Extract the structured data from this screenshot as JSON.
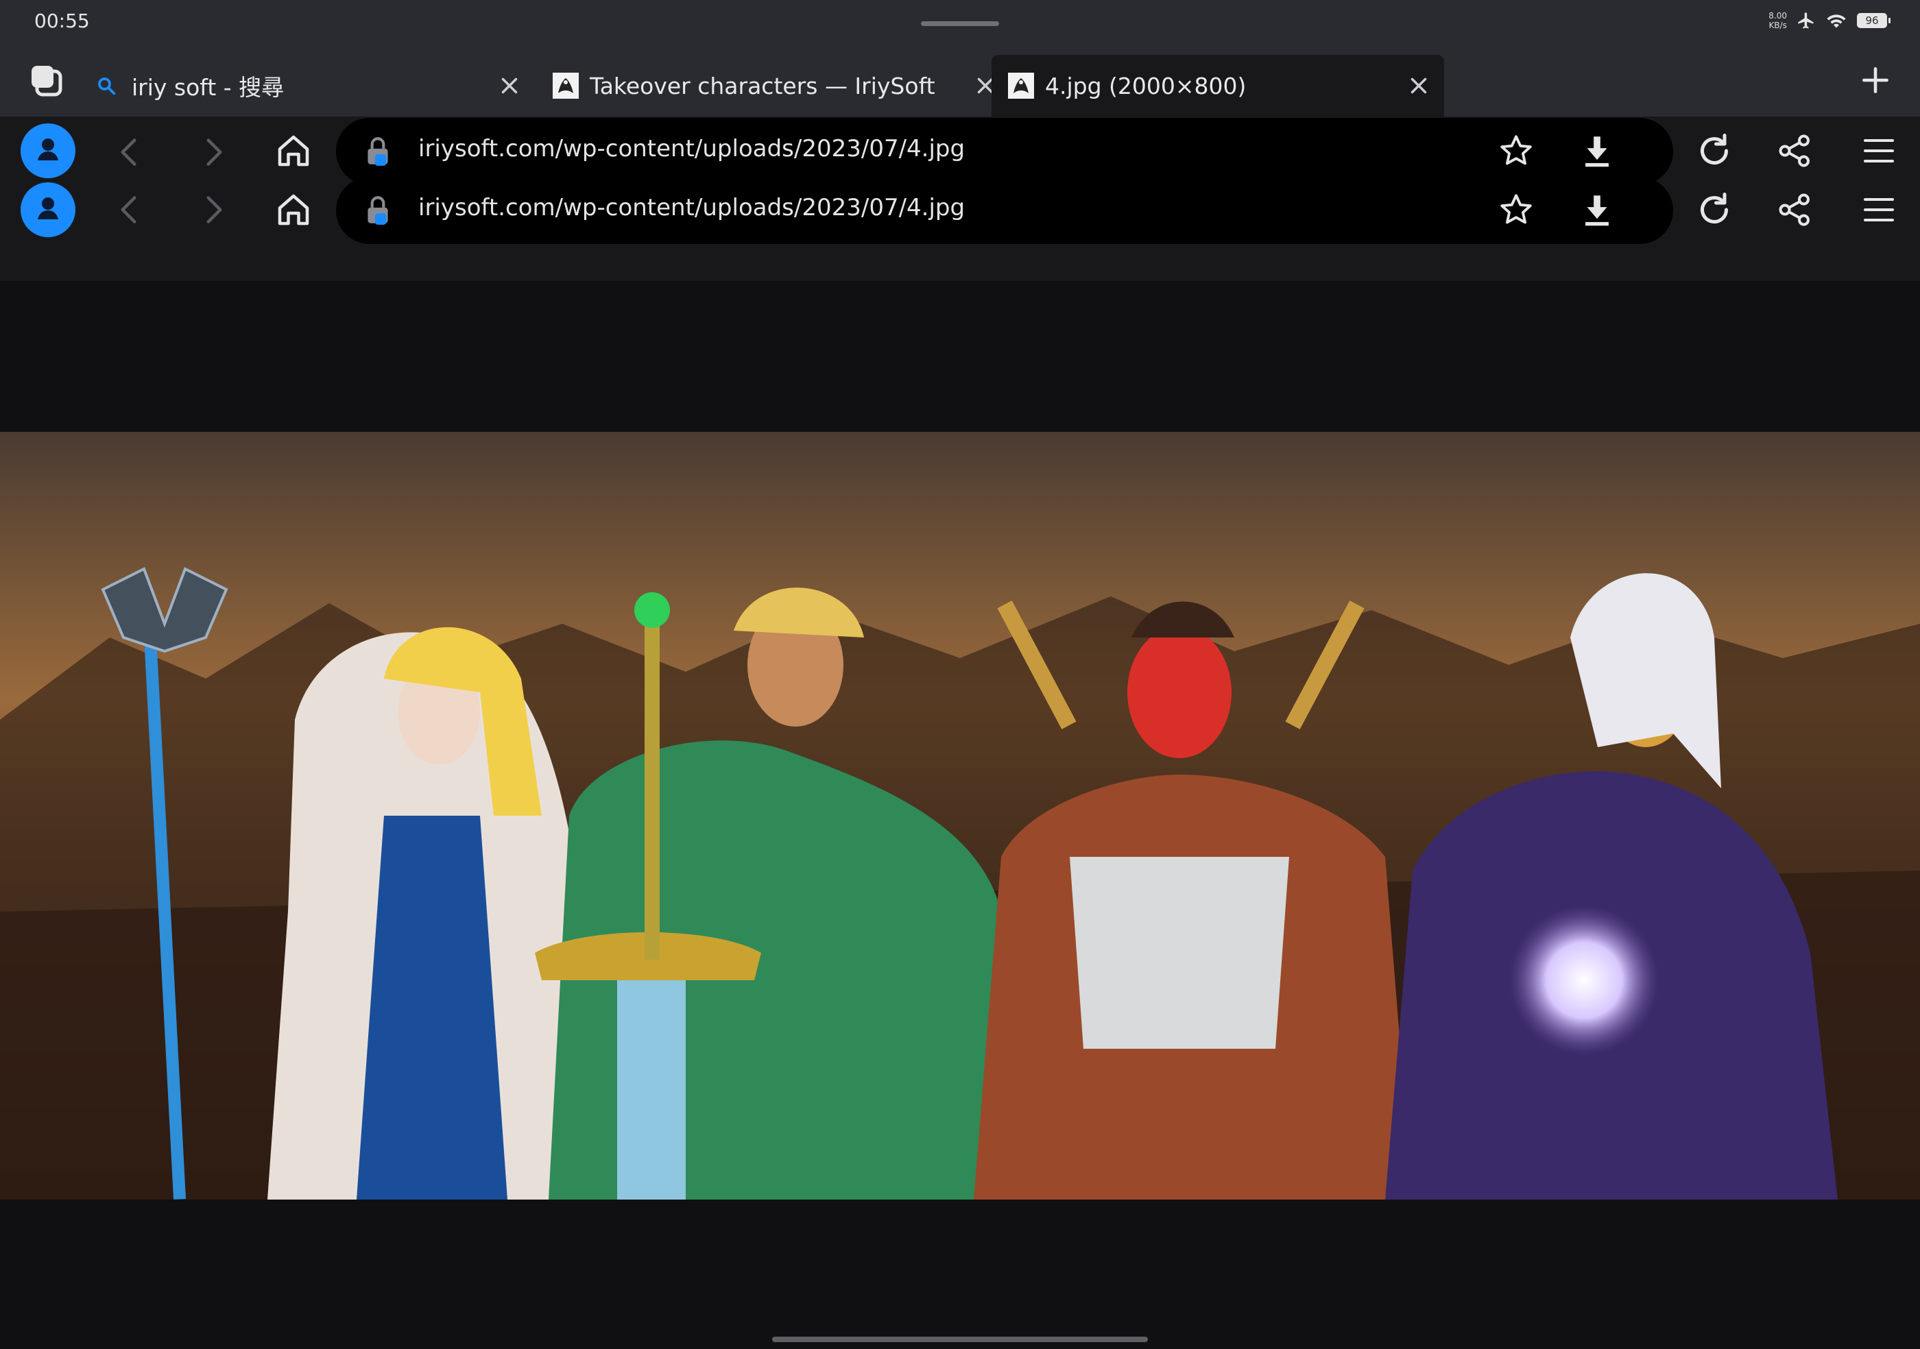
{
  "status": {
    "time": "00:55",
    "net_speed_value": "8.00",
    "net_speed_unit": "KB/s",
    "battery": "96"
  },
  "tabs": [
    {
      "label": "iriy soft - 搜尋",
      "icon": "search-icon",
      "active": false
    },
    {
      "label": "Takeover characters — IriySoft",
      "icon": "iriysoft-favicon",
      "active": false
    },
    {
      "label": "4.jpg (2000×800)",
      "icon": "iriysoft-favicon",
      "active": true
    }
  ],
  "toolbar": {
    "url": "iriysoft.com/wp-content/uploads/2023/07/4.jpg"
  },
  "colors": {
    "accent": "#1a8cff",
    "tab_strip": "#2a2b30",
    "toolbar": "#18181b",
    "page_bg": "#101012"
  },
  "icons": {
    "tab_switcher": "tab-switcher-icon",
    "new_tab": "plus-icon",
    "profile": "profile-icon",
    "back": "chevron-left-icon",
    "forward": "chevron-right-icon",
    "home": "home-icon",
    "lock": "lock-icon",
    "bookmark": "star-icon",
    "download": "download-icon",
    "reload": "reload-icon",
    "share": "share-icon",
    "menu": "menu-icon"
  }
}
